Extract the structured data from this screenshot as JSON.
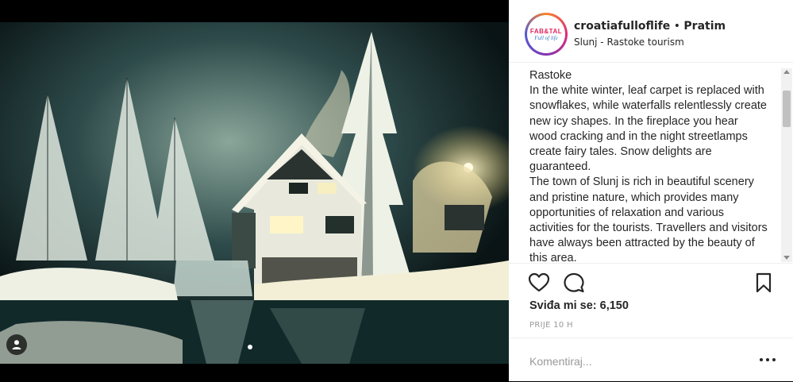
{
  "post": {
    "image": {
      "description_icon": "user-tag-icon",
      "carousel_indicator": "dot"
    }
  },
  "header": {
    "avatar_logo_top": "FAB&TAL",
    "avatar_logo_bottom": "Full of life",
    "username": "croatiafulloflife",
    "separator": " • ",
    "follow_label": "Pratim",
    "location": "Slunj - Rastoke tourism"
  },
  "caption": {
    "lines": [
      "Rastoke",
      "In the white winter, leaf carpet is replaced with snowflakes, while waterfalls relentlessly create new icy shapes. In the fireplace you hear wood cracking and in the night streetlamps create fairy tales. Snow delights are guaranteed.",
      "The town of Slunj is rich in beautiful scenery and pristine nature, which provides many opportunities of relaxation and various activities for the tourists. Travellers and visitors have always been attracted by the beauty of this area."
    ]
  },
  "actions": {
    "like_icon": "heart-icon",
    "comment_icon": "comment-icon",
    "save_icon": "bookmark-icon"
  },
  "likes_text": "Sviđa mi se: 6,150",
  "timestamp": "PRIJE 10 H",
  "comment": {
    "placeholder": "Komentiraj...",
    "more_icon": "more-options-icon"
  },
  "colors": {
    "text": "#262626",
    "muted": "#999999",
    "border": "#efefef"
  }
}
